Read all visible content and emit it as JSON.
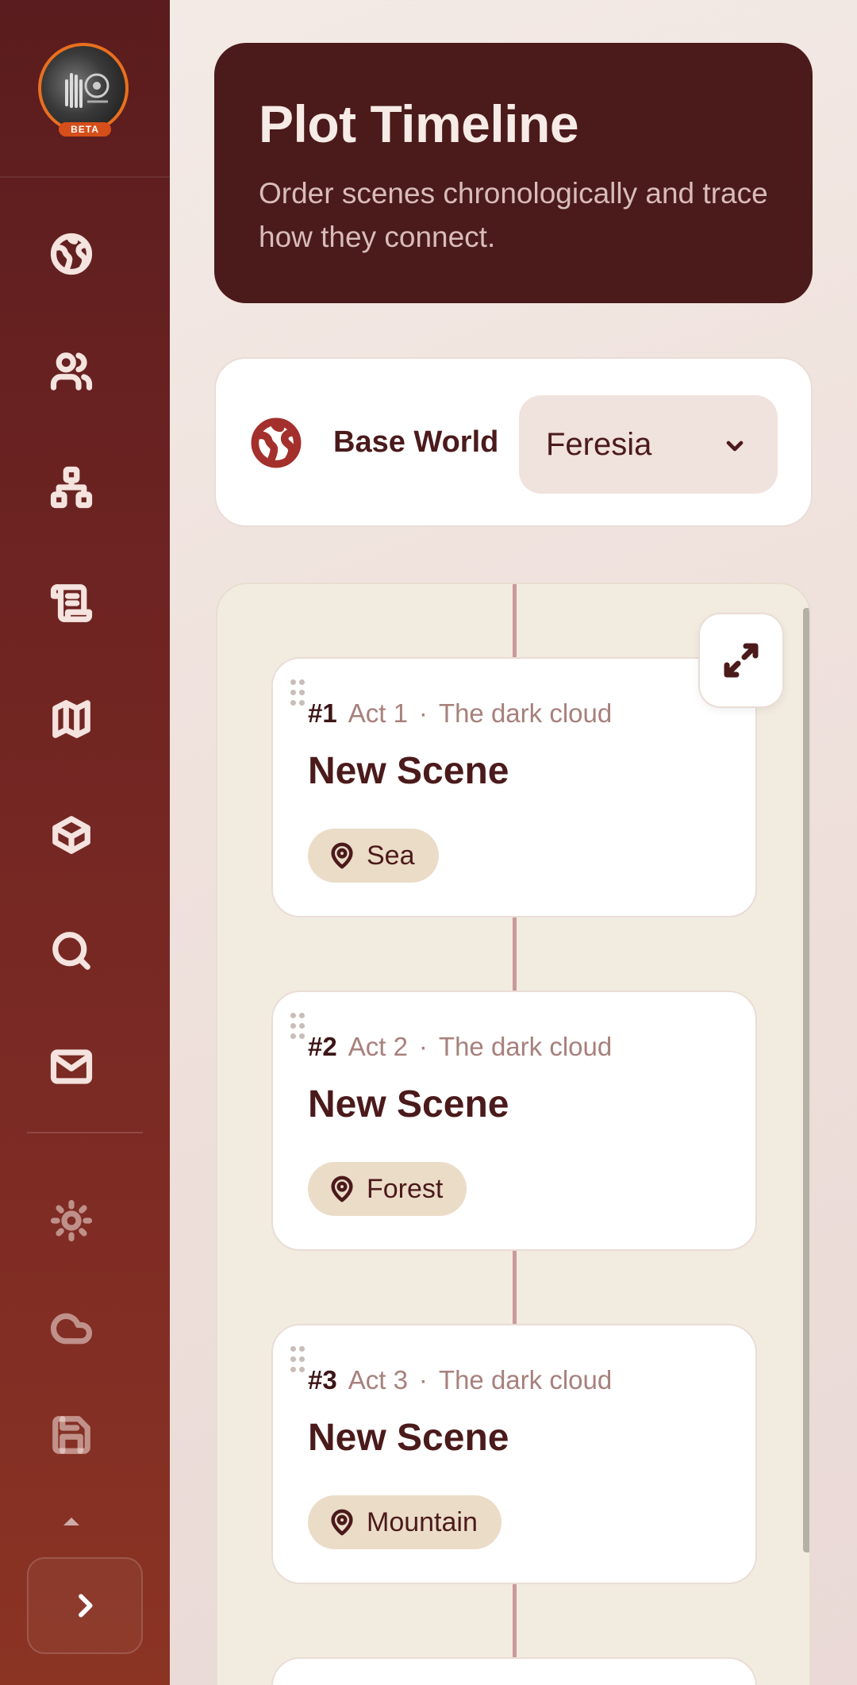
{
  "sidebar": {
    "avatar_badge": "BETA",
    "nav": [
      {
        "icon": "globe-icon"
      },
      {
        "icon": "users-icon"
      },
      {
        "icon": "hierarchy-icon"
      },
      {
        "icon": "scroll-icon"
      },
      {
        "icon": "map-icon"
      },
      {
        "icon": "box-icon"
      },
      {
        "icon": "search-icon"
      },
      {
        "icon": "mail-icon"
      }
    ],
    "utility": [
      {
        "icon": "sun-icon"
      },
      {
        "icon": "cloud-icon"
      },
      {
        "icon": "save-icon"
      }
    ],
    "expand_icon": "chevron-right-icon"
  },
  "header": {
    "title": "Plot Timeline",
    "subtitle": "Order scenes chronologically and trace how they connect."
  },
  "world_selector": {
    "label": "Base World",
    "selected": "Feresia",
    "icon": "globe-icon"
  },
  "timeline": {
    "scenes": [
      {
        "number": "#1",
        "act": "Act 1",
        "separator": "·",
        "arc": "The dark cloud",
        "title": "New Scene",
        "location": "Sea"
      },
      {
        "number": "#2",
        "act": "Act 2",
        "separator": "·",
        "arc": "The dark cloud",
        "title": "New Scene",
        "location": "Forest"
      },
      {
        "number": "#3",
        "act": "Act 3",
        "separator": "·",
        "arc": "The dark cloud",
        "title": "New Scene",
        "location": "Mountain"
      }
    ]
  },
  "colors": {
    "sidebar_top": "#5a1c1e",
    "sidebar_bottom": "#8b3424",
    "header_bg": "#4b1a1b",
    "accent": "#a3302c",
    "pill_bg": "#ebdcc8"
  }
}
